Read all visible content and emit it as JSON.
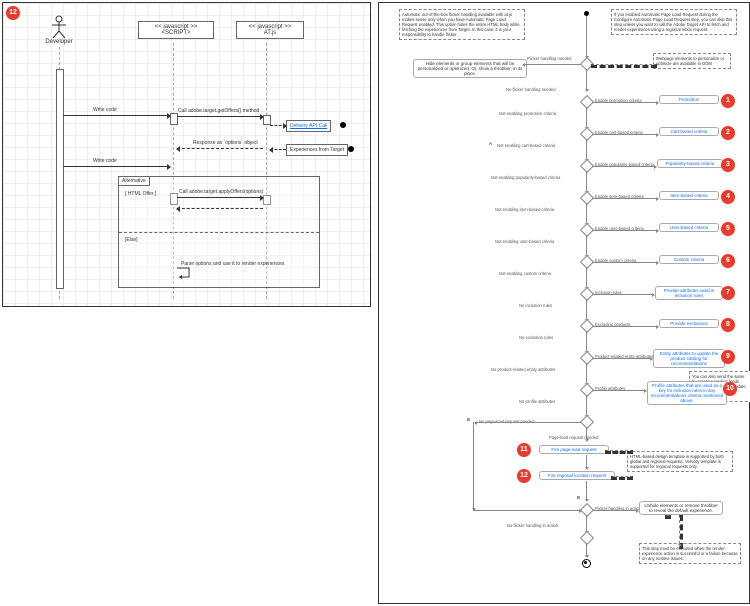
{
  "seq": {
    "actor": "Developer",
    "lane_script": "<< javascript >>\n<SCRIPT>",
    "lane_atjs": "<< javascript >>\nAT.js",
    "msg_write1": "Write code",
    "msg_getoffers": "Call adobe.target.getOffers() method",
    "note_delivery": "Delivery API Call",
    "msg_response": "Response as `options` object",
    "note_experiences": "Experiences from Target",
    "msg_write2": "Write code",
    "alt_title": "Alternative",
    "alt_cond1": "[ HTML Offer ]",
    "msg_applyoffers": "Call adobe.target.applyOffers(options)",
    "alt_cond2": "[Else]",
    "msg_parse": "Parse options and use it to render experiences"
  },
  "flow": {
    "top_note_left": "Automatic out-of-the-box flicker handling available with at.js makes sense only when you have Automatic Page Load Request enabled. This option hides the entire HTML body while fetching the experiences from Target. In this case, it is your responsibility to handle flicker.",
    "top_note_right": "If you enabled Automatic Page Load Request during the Configure Automatic Page Load Request step, you can skip this step unless you want to call the Adobe Target API to fetch and render experiences using a regional mbox request.",
    "hide_elements": "Hide elements or group elements that will be personalized or optimized. Or, show a throbber, in its place.",
    "flicker_needed": "Flicker handling needed",
    "webpage_dom": "Webpage elements to personalize or optimize are available in DOM",
    "no_flicker": "No flicker handling needed",
    "rows": [
      {
        "q": "Enable promotion criteria",
        "link": "Promotion",
        "neg": "Not enabling promotion criteria"
      },
      {
        "q": "Enable cart-based criteria",
        "link": "Cart-based criteria",
        "neg": "Not enabling cart-based criteria"
      },
      {
        "q": "Enable popularity-based criteria",
        "link": "Popularity-based criteria",
        "neg": "Not enabling popularity-based criteria"
      },
      {
        "q": "Enable item-based criteria",
        "link": "Item-based criteria",
        "neg": "Not enabling item-based criteria"
      },
      {
        "q": "Enable user-based criteria",
        "link": "User-based criteria",
        "neg": "Not enabling user-based criteria"
      },
      {
        "q": "Enable custom criteria",
        "link": "Custom criteria",
        "neg": "Not enabling custom criteria"
      },
      {
        "q": "Inclusion rules",
        "link": "Provide attributes used in inclusion rules",
        "neg": "No inclusion rules"
      },
      {
        "q": "Excluding products",
        "link": "Provide exclusions",
        "neg": "No exclusion rules"
      },
      {
        "q": "Product-related entity attributes",
        "link": "Entity attributes to update the product catalog for recommendations",
        "neg": "No product-related entity attributes"
      },
      {
        "q": "Profile attributes",
        "link": "Profile attributes that are used as a key for inclusion rules in any recommendations criteria mentioned above.",
        "neg": "No profile attributes"
      }
    ],
    "side_note": "You can also send the same by creating product feeds using the Target UI to update the product catalog for recommendations.",
    "no_pageload": "No page-load request needed",
    "pageload_needed": "Page-load request needed",
    "fire_pageload": "Fire page-load request",
    "fire_regional": "Fire regional-location request",
    "html_template": "HTML-based design template is supported by both global and regional requests. Velocity template is supported for regional requests only.",
    "flicker_action": "Flicker handling in action",
    "unhide": "Unhide elements or remove throbber to reveal the default experience.",
    "no_flicker_action": "No flicker handling in action",
    "final_note": "This step must be executed when the render-experience action is successful or a failure because on any runtime issues."
  },
  "badges": [
    "12",
    "1",
    "2",
    "3",
    "4",
    "5",
    "6",
    "7",
    "8",
    "9",
    "10",
    "11",
    "12"
  ]
}
